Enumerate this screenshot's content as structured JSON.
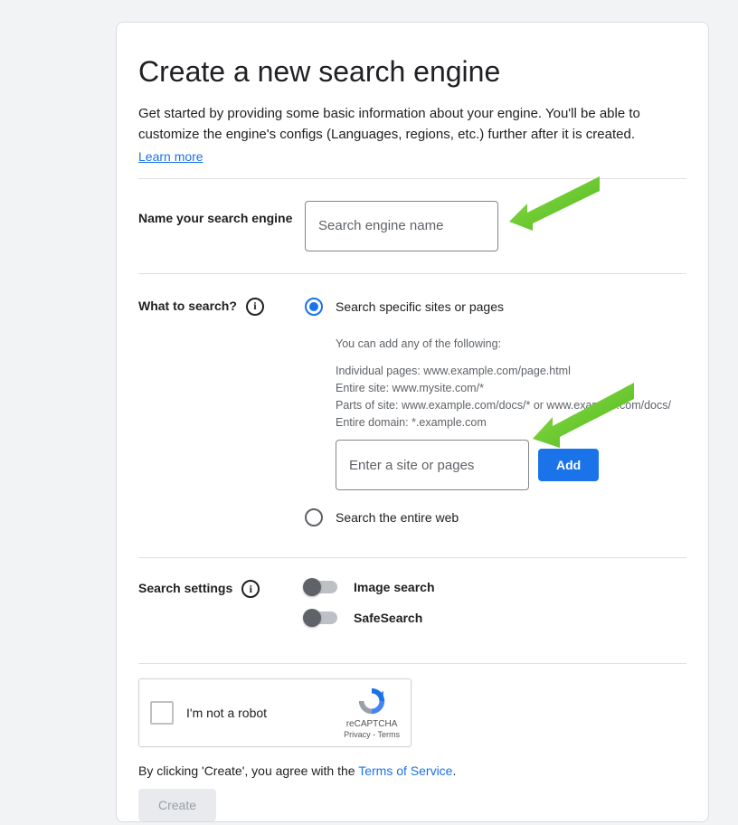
{
  "title": "Create a new search engine",
  "intro_text": "Get started by providing some basic information about your engine. You'll be able to customize the engine's configs (Languages, regions, etc.) further after it is created.",
  "learn_more": "Learn more",
  "name_section": {
    "label": "Name your search engine",
    "placeholder": "Search engine name"
  },
  "what_section": {
    "label": "What to search?",
    "option_specific": "Search specific sites or pages",
    "option_web": "Search the entire web",
    "help_title": "You can add any of the following:",
    "help_lines": [
      "Individual pages: www.example.com/page.html",
      "Entire site: www.mysite.com/*",
      "Parts of site: www.example.com/docs/* or www.example.com/docs/",
      "Entire domain: *.example.com"
    ],
    "site_placeholder": "Enter a site or pages",
    "add_button": "Add"
  },
  "settings_section": {
    "label": "Search settings",
    "image_search": "Image search",
    "safesearch": "SafeSearch"
  },
  "captcha": {
    "text": "I'm not a robot",
    "brand": "reCAPTCHA",
    "privacy": "Privacy",
    "terms": "Terms"
  },
  "agree_prefix": "By clicking 'Create', you agree with the ",
  "agree_link": "Terms of Service",
  "agree_suffix": ".",
  "create_button": "Create"
}
